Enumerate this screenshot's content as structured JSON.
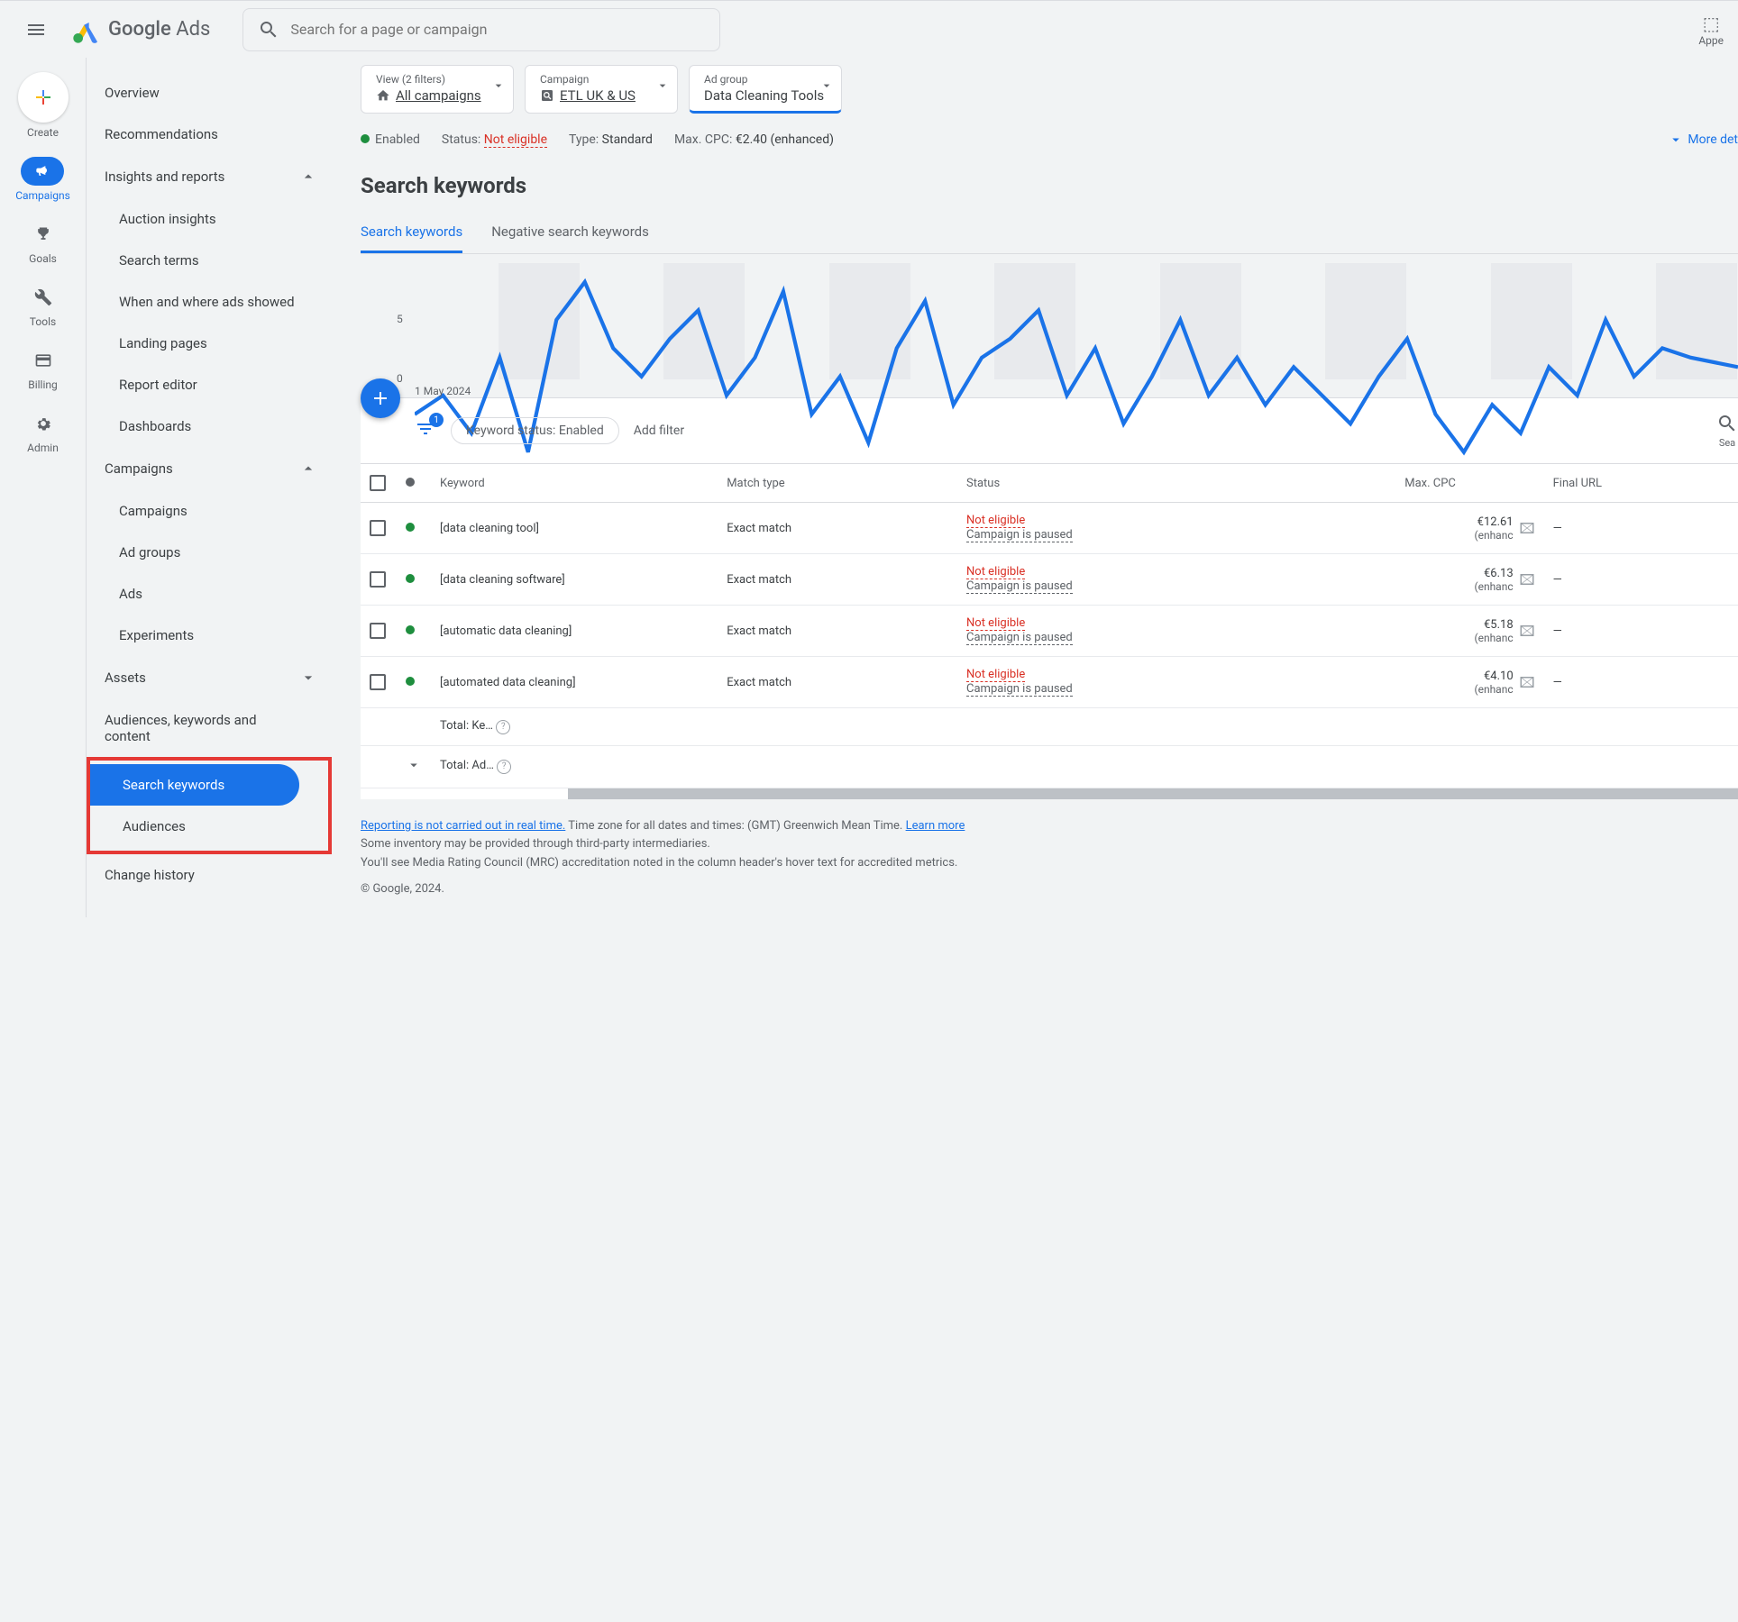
{
  "topbar": {
    "logo_text_1": "Google",
    "logo_text_2": "Ads",
    "search_placeholder": "Search for a page or campaign",
    "right_label": "Appe"
  },
  "rail": {
    "create": "Create",
    "campaigns": "Campaigns",
    "goals": "Goals",
    "tools": "Tools",
    "billing": "Billing",
    "admin": "Admin"
  },
  "sidebar": {
    "overview": "Overview",
    "recommendations": "Recommendations",
    "insights": "Insights and reports",
    "insights_items": {
      "auction": "Auction insights",
      "search_terms": "Search terms",
      "when_where": "When and where ads showed",
      "landing": "Landing pages",
      "report_editor": "Report editor",
      "dashboards": "Dashboards"
    },
    "campaigns": "Campaigns",
    "campaigns_items": {
      "campaigns": "Campaigns",
      "ad_groups": "Ad groups",
      "ads": "Ads",
      "experiments": "Experiments"
    },
    "assets": "Assets",
    "audiences": "Audiences, keywords and content",
    "audiences_items": {
      "search_keywords": "Search keywords",
      "audiences": "Audiences"
    },
    "change_history": "Change history"
  },
  "breadcrumbs": {
    "view": {
      "label": "View (2 filters)",
      "value": "All campaigns"
    },
    "campaign": {
      "label": "Campaign",
      "value": "ETL UK & US"
    },
    "adgroup": {
      "label": "Ad group",
      "value": "Data Cleaning Tools"
    }
  },
  "status_row": {
    "enabled": "Enabled",
    "status_label": "Status:",
    "status_value": "Not eligible",
    "type_label": "Type:",
    "type_value": "Standard",
    "cpc_label": "Max. CPC:",
    "cpc_value": "€2.40 (enhanced)",
    "more": "More det"
  },
  "page_title": "Search keywords",
  "tabs": {
    "search_keywords": "Search keywords",
    "negative": "Negative search keywords"
  },
  "chart": {
    "y_5": "5",
    "y_0": "0",
    "x_label": "1 May 2024"
  },
  "toolbar": {
    "filter_count": "1",
    "chip": "Keyword status: Enabled",
    "add_filter": "Add filter",
    "search_label": "Sea"
  },
  "table": {
    "headers": {
      "keyword": "Keyword",
      "match": "Match type",
      "status": "Status",
      "cpc": "Max. CPC",
      "final_url": "Final URL"
    },
    "rows": [
      {
        "keyword": "[data cleaning tool]",
        "match": "Exact match",
        "status1": "Not eligible",
        "status2": "Campaign is paused",
        "cpc": "€12.61",
        "cpc2": "(enhanc",
        "url": "—"
      },
      {
        "keyword": "[data cleaning software]",
        "match": "Exact match",
        "status1": "Not eligible",
        "status2": "Campaign is paused",
        "cpc": "€6.13",
        "cpc2": "(enhanc",
        "url": "—"
      },
      {
        "keyword": "[automatic data cleaning]",
        "match": "Exact match",
        "status1": "Not eligible",
        "status2": "Campaign is paused",
        "cpc": "€5.18",
        "cpc2": "(enhanc",
        "url": "—"
      },
      {
        "keyword": "[automated data cleaning]",
        "match": "Exact match",
        "status1": "Not eligible",
        "status2": "Campaign is paused",
        "cpc": "€4.10",
        "cpc2": "(enhanc",
        "url": "—"
      }
    ],
    "total_keywords": "Total: Ke…",
    "total_adgroup": "Total: Ad…"
  },
  "footer": {
    "link1": "Reporting is not carried out in real time.",
    "text1": " Time zone for all dates and times: (GMT) Greenwich Mean Time. ",
    "link2": "Learn more",
    "text2": "Some inventory may be provided through third-party intermediaries.",
    "text3": "You'll see Media Rating Council (MRC) accreditation noted in the column header's hover text for accredited metrics.",
    "copyright": "© Google, 2024."
  }
}
